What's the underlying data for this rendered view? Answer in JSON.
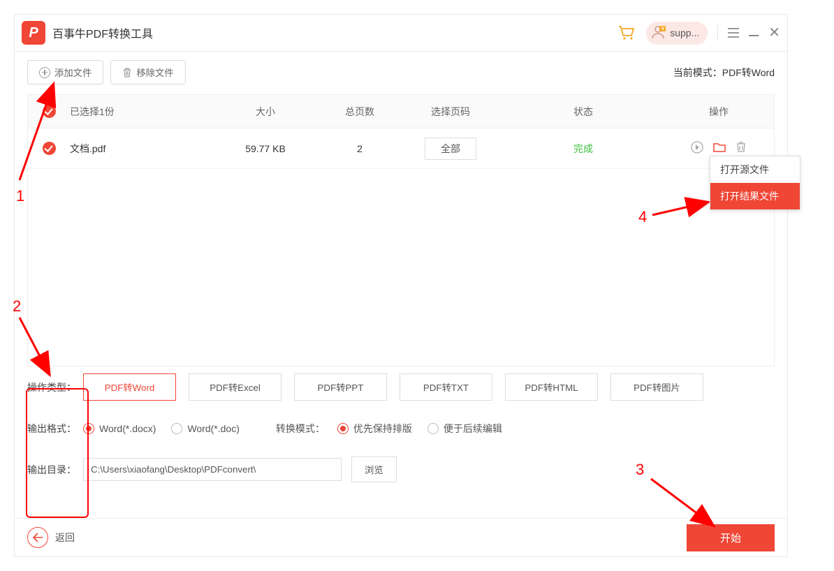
{
  "titlebar": {
    "app_name": "百事牛PDF转换工具",
    "user_label": "supp..."
  },
  "toolbar": {
    "add_file": "添加文件",
    "remove_file": "移除文件",
    "mode_prefix": "当前模式：",
    "mode_value": "PDF转Word"
  },
  "table": {
    "headers": {
      "selected": "已选择1份",
      "size": "大小",
      "pages": "总页数",
      "select_pages": "选择页码",
      "status": "状态",
      "ops": "操作"
    },
    "rows": [
      {
        "name": "文档.pdf",
        "size": "59.77 KB",
        "pages": "2",
        "select_label": "全部",
        "status": "完成"
      }
    ]
  },
  "context_menu": {
    "open_source": "打开源文件",
    "open_result": "打开结果文件"
  },
  "options": {
    "op_type_label": "操作类型：",
    "types": [
      "PDF转Word",
      "PDF转Excel",
      "PDF转PPT",
      "PDF转TXT",
      "PDF转HTML",
      "PDF转图片"
    ],
    "out_format_label": "输出格式：",
    "formats": [
      "Word(*.docx)",
      "Word(*.doc)"
    ],
    "convert_mode_label": "转换模式：",
    "convert_modes": [
      "优先保持排版",
      "便于后续编辑"
    ],
    "out_dir_label": "输出目录：",
    "out_dir_value": "C:\\Users\\xiaofang\\Desktop\\PDFconvert\\",
    "browse": "浏览"
  },
  "footer": {
    "back": "返回",
    "start": "开始"
  },
  "annotations": {
    "n1": "1",
    "n2": "2",
    "n3": "3",
    "n4": "4"
  }
}
